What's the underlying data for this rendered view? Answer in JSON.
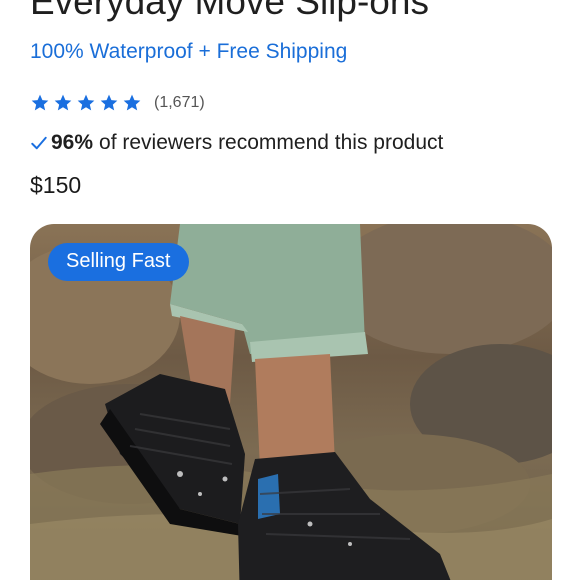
{
  "product": {
    "title": "Everyday Move Slip-ons",
    "subtitle": "100% Waterproof + Free Shipping",
    "rating": {
      "stars": 5,
      "count": "(1,671)"
    },
    "recommend": {
      "percent": "96%",
      "text": "of reviewers recommend this product"
    },
    "price": "$150"
  },
  "image": {
    "badge": "Selling Fast"
  },
  "colors": {
    "accent": "#1a6fe0",
    "star": "#1a6fe0",
    "text": "#1a1a1a"
  },
  "icons": {
    "star": "star-icon",
    "check": "checkmark-icon"
  }
}
